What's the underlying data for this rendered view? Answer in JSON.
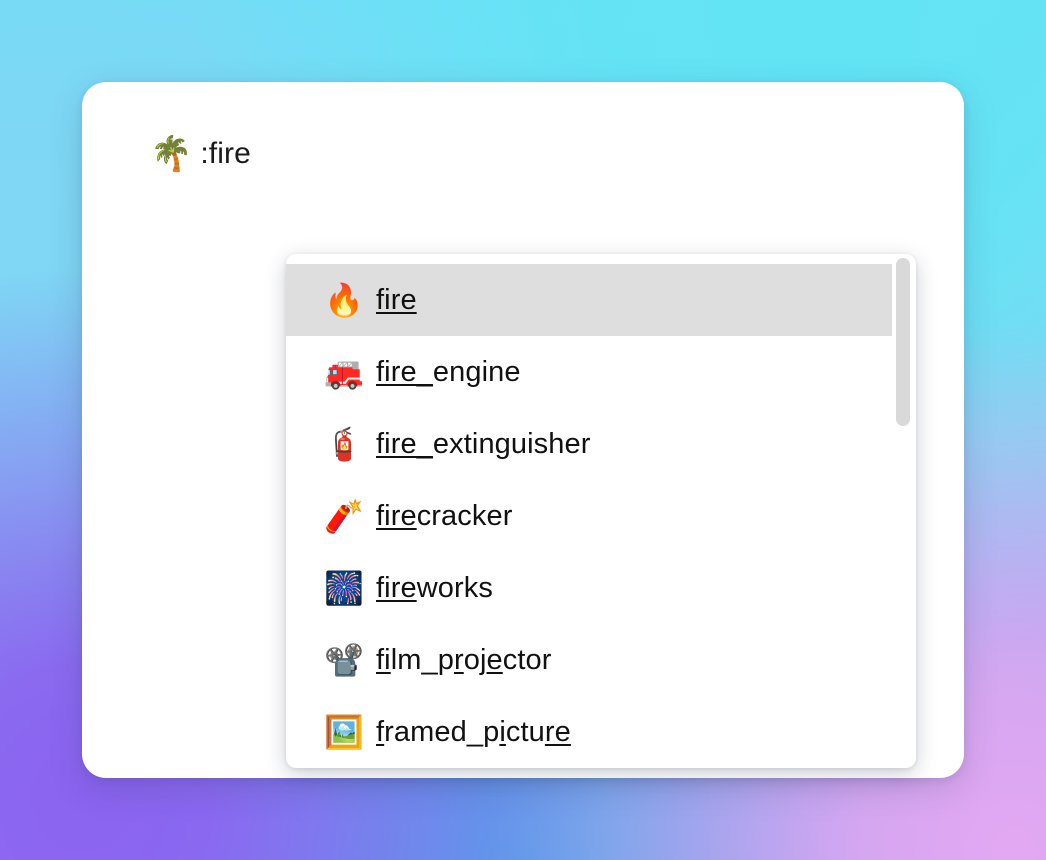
{
  "window": {
    "background_top_color": "#6fe0f6",
    "background_bottom_left_color": "#8b63f0",
    "background_bottom_right_color": "#e3a8f2",
    "card_color": "#ffffff"
  },
  "input": {
    "emoji": "🌴",
    "emoji_name": "palm_tree",
    "value": ":fire",
    "placeholder": ""
  },
  "dropdown": {
    "selected_index": 0,
    "highlight_color": "#dedede",
    "scrollbar": {
      "thumb_color": "#d9d9d9",
      "thumb_top": 0,
      "thumb_height": 168
    },
    "items": [
      {
        "emoji": "🔥",
        "emoji_name": "fire",
        "label": "fire",
        "segments": [
          {
            "text": "fire",
            "matched": true
          }
        ]
      },
      {
        "emoji": "🚒",
        "emoji_name": "fire_engine",
        "label": "fire_engine",
        "segments": [
          {
            "text": "fire_",
            "matched": true
          },
          {
            "text": "engine",
            "matched": false
          }
        ]
      },
      {
        "emoji": "🧯",
        "emoji_name": "fire_extinguisher",
        "label": "fire_extinguisher",
        "segments": [
          {
            "text": "fire_",
            "matched": true
          },
          {
            "text": "extinguisher",
            "matched": false
          }
        ]
      },
      {
        "emoji": "🧨",
        "emoji_name": "firecracker",
        "label": "firecracker",
        "segments": [
          {
            "text": "fire",
            "matched": true
          },
          {
            "text": "cracker",
            "matched": false
          }
        ]
      },
      {
        "emoji": "🎆",
        "emoji_name": "fireworks",
        "label": "fireworks",
        "segments": [
          {
            "text": "fire",
            "matched": true
          },
          {
            "text": "works",
            "matched": false
          }
        ]
      },
      {
        "emoji": "📽️",
        "emoji_name": "film_projector",
        "label": "film_projector",
        "segments": [
          {
            "text": "fi",
            "matched": true
          },
          {
            "text": "lm_p",
            "matched": false
          },
          {
            "text": "r",
            "matched": true
          },
          {
            "text": "oj",
            "matched": false
          },
          {
            "text": "e",
            "matched": true
          },
          {
            "text": "ctor",
            "matched": false
          }
        ]
      },
      {
        "emoji": "🖼️",
        "emoji_name": "framed_picture",
        "label": "framed_picture",
        "segments": [
          {
            "text": "f",
            "matched": true
          },
          {
            "text": "ramed_p",
            "matched": false
          },
          {
            "text": "i",
            "matched": true
          },
          {
            "text": "ctu",
            "matched": false
          },
          {
            "text": "re",
            "matched": true
          }
        ]
      }
    ]
  }
}
